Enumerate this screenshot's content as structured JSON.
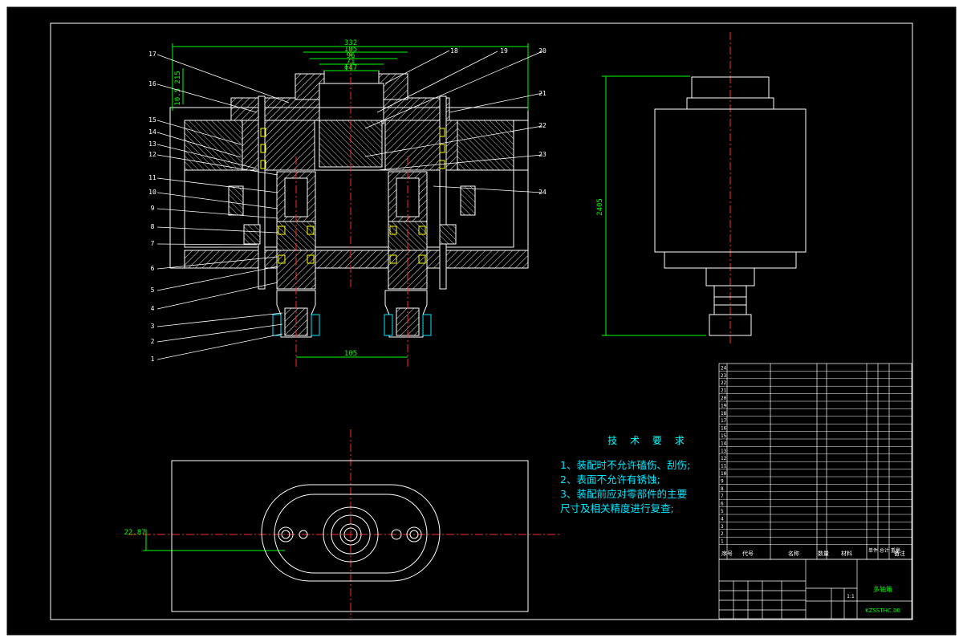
{
  "dimensions": {
    "overall_width": "332",
    "d1": "105",
    "d2": "96",
    "d3": "71",
    "d4": "Φ47",
    "bottom_spacing": "105",
    "height": "2405",
    "offset": "22.87",
    "left_small": "10.5 215"
  },
  "balloons_left": [
    "17",
    "16",
    "15",
    "14",
    "13",
    "12",
    "11",
    "10",
    "9",
    "8",
    "7",
    "6",
    "5",
    "4",
    "3",
    "2",
    "1"
  ],
  "balloons_right": [
    "18",
    "19",
    "20",
    "21",
    "22",
    "23",
    "24"
  ],
  "tech_notes": {
    "title": "技 术 要 求",
    "lines": [
      "1、装配时不允许磕伤、刮伤;",
      "2、表面不允许有锈蚀;",
      "3、装配前应对零部件的主要",
      "尺寸及相关精度进行复查;"
    ]
  },
  "bom": {
    "header": [
      "序号",
      "代号",
      "名称",
      "数量",
      "材料",
      "单件 总计 重量",
      "备注"
    ],
    "item_numbers": [
      "24",
      "23",
      "22",
      "21",
      "20",
      "19",
      "18",
      "17",
      "16",
      "15",
      "14",
      "13",
      "12",
      "11",
      "10",
      "9",
      "8",
      "7",
      "6",
      "5",
      "4",
      "3",
      "2",
      "1"
    ]
  },
  "title_block": {
    "drawing_name": "多轴箱",
    "drawing_code": "KZSSTHC.00",
    "scale": "1:1"
  },
  "colors": {
    "outline": "#ffffff",
    "centerline": "#ff2a2a",
    "dimension": "#00ff00",
    "hatch": "#ffffff",
    "text_notes": "#00e8ff",
    "bearing": "#ffff00"
  }
}
